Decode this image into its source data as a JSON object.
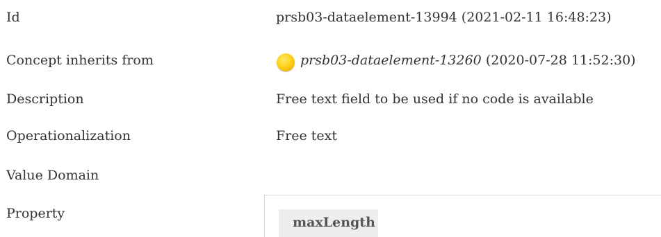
{
  "rows": {
    "id": {
      "label": "Id",
      "value": "prsb03-dataelement-13994 (2021-02-11 16:48:23)"
    },
    "inherits": {
      "label": "Concept inherits from",
      "ref_id": "prsb03-dataelement-13260",
      "ref_date": "(2020-07-28 11:52:30)",
      "icon": "yellow-status-dot-icon",
      "icon_color": "#ffd21a"
    },
    "description": {
      "label": "Description",
      "value": "Free text field to be used if no code is available"
    },
    "operationalization": {
      "label": "Operationalization",
      "value": "Free text"
    },
    "value_domain": {
      "label": "Value Domain"
    },
    "property": {
      "label": "Property",
      "chip_text": "maxLength"
    }
  }
}
